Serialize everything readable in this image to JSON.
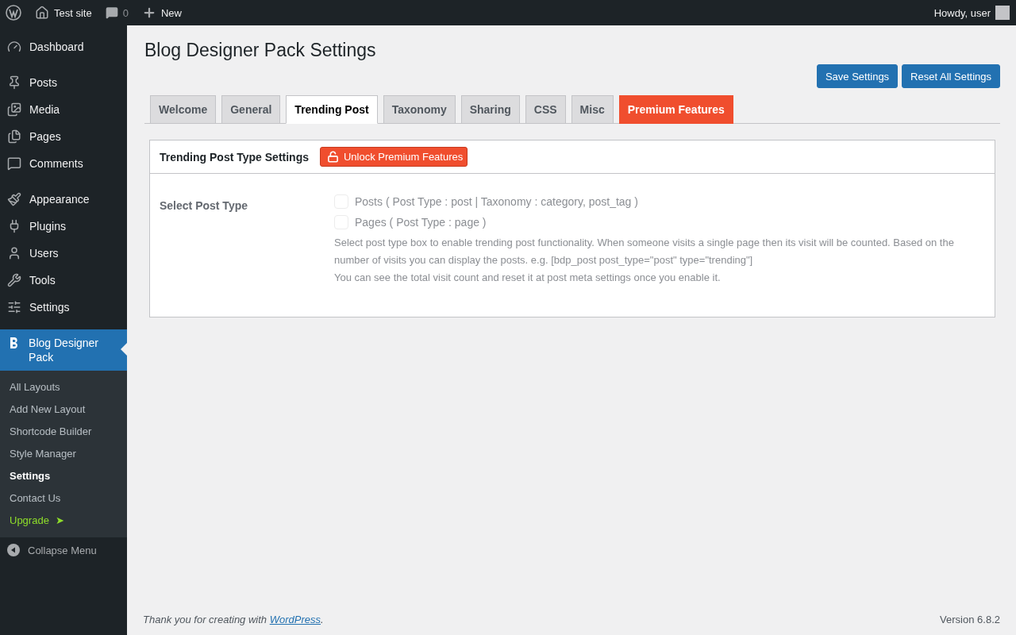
{
  "admin_bar": {
    "site": "Test site",
    "comments": "0",
    "new": "New",
    "greeting": "Howdy, user"
  },
  "sidebar": {
    "groups": [
      {
        "items": [
          {
            "label": "Dashboard"
          }
        ]
      },
      {
        "items": [
          {
            "label": "Posts"
          },
          {
            "label": "Media"
          },
          {
            "label": "Pages"
          },
          {
            "label": "Comments"
          }
        ]
      },
      {
        "items": [
          {
            "label": "Appearance"
          },
          {
            "label": "Plugins"
          },
          {
            "label": "Users"
          },
          {
            "label": "Tools"
          },
          {
            "label": "Settings"
          }
        ]
      }
    ],
    "current": {
      "label": "Blog Designer Pack",
      "submenu": [
        {
          "label": "All Layouts",
          "selected": false,
          "kind": "link"
        },
        {
          "label": "Add New Layout",
          "selected": false,
          "kind": "link"
        },
        {
          "label": "Shortcode Builder",
          "selected": false,
          "kind": "link"
        },
        {
          "label": "Style Manager",
          "selected": false,
          "kind": "link"
        },
        {
          "label": "Settings",
          "selected": true,
          "kind": "link"
        },
        {
          "label": "Contact Us",
          "selected": false,
          "kind": "link"
        },
        {
          "label": "Upgrade",
          "selected": false,
          "kind": "upgrade",
          "arrow": "➤"
        }
      ]
    },
    "collapse": "Collapse Menu"
  },
  "page": {
    "title": "Blog Designer Pack Settings",
    "buttons": [
      "Save Settings",
      "Reset All Settings"
    ],
    "tabs": [
      {
        "label": "Welcome",
        "selected": false,
        "kind": "normal"
      },
      {
        "label": "General",
        "selected": false,
        "kind": "normal"
      },
      {
        "label": "Trending Post",
        "selected": true,
        "kind": "normal"
      },
      {
        "label": "Taxonomy",
        "selected": false,
        "kind": "normal"
      },
      {
        "label": "Sharing",
        "selected": false,
        "kind": "normal"
      },
      {
        "label": "CSS",
        "selected": false,
        "kind": "normal"
      },
      {
        "label": "Misc",
        "selected": false,
        "kind": "normal"
      },
      {
        "label": "Premium Features",
        "selected": false,
        "kind": "premium"
      }
    ],
    "panel": {
      "title": "Trending Post Type Settings",
      "unlock": "Unlock Premium Features",
      "field_label": "Select Post Type",
      "options": [
        {
          "label": "Posts ( Post Type : post | Taxonomy : category, post_tag )",
          "checked": false,
          "disabled": true
        },
        {
          "label": "Pages ( Post Type : page )",
          "checked": false,
          "disabled": true
        }
      ],
      "help": [
        "Select post type box to enable trending post functionality. When someone visits a single page then its visit will be counted. Based on the number of visits you can display the posts. e.g. [bdp_post post_type=\"post\" type=\"trending\"]",
        "You can see the total visit count and reset it at post meta settings once you enable it."
      ]
    }
  },
  "footer": {
    "thanks": "Thank you for creating with ",
    "link": "WordPress",
    "end": ".",
    "version": "Version 6.8.2"
  }
}
